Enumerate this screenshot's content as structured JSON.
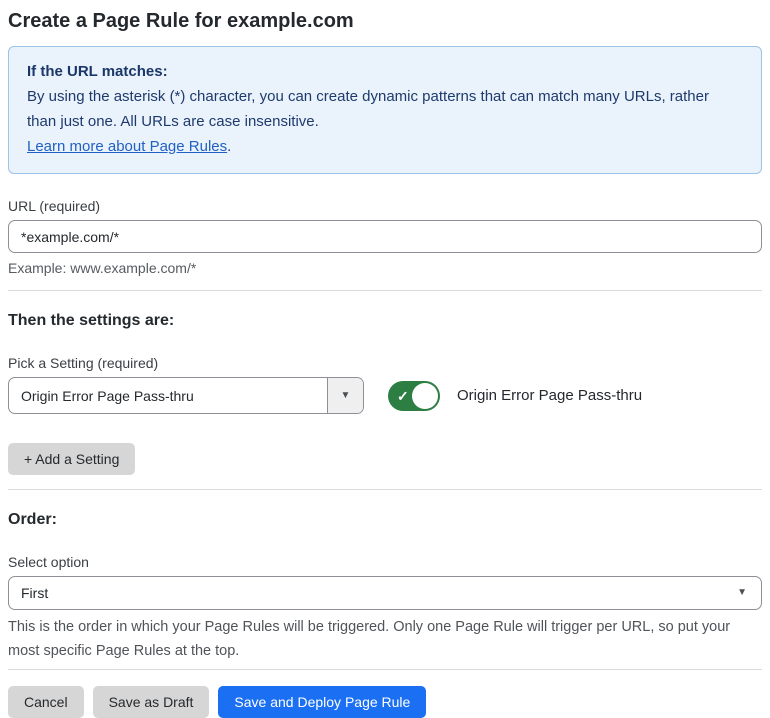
{
  "page": {
    "title": "Create a Page Rule for example.com"
  },
  "info_box": {
    "heading": "If the URL matches:",
    "body": "By using the asterisk (*) character, you can create dynamic patterns that can match many URLs, rather than just one. All URLs are case insensitive.",
    "link_label": "Learn more about Page Rules",
    "link_suffix": "."
  },
  "url_field": {
    "label": "URL (required)",
    "value": "*example.com/*",
    "hint": "Example: www.example.com/*"
  },
  "settings_section": {
    "heading": "Then the settings are:",
    "picker_label": "Pick a Setting (required)",
    "picker_value": "Origin Error Page Pass-thru",
    "toggle_label": "Origin Error Page Pass-thru",
    "toggle_state": "on",
    "add_setting_label": "+ Add a Setting"
  },
  "order_section": {
    "heading": "Order:",
    "select_label": "Select option",
    "select_value": "First",
    "hint": "This is the order in which your Page Rules will be triggered. Only one Page Rule will trigger per URL, so put your most specific Page Rules at the top."
  },
  "footer": {
    "cancel_label": "Cancel",
    "save_draft_label": "Save as Draft",
    "save_deploy_label": "Save and Deploy Page Rule"
  },
  "glyphs": {
    "dropdown_arrow": "▼",
    "check": "✓"
  },
  "colors": {
    "info_box_bg": "#eaf3fb",
    "info_box_border": "#9ec3e8",
    "info_text": "#1e3a6d",
    "link_blue": "#2160c4",
    "toggle_on_green": "#2c7e43",
    "primary_button_blue": "#1a6ff2",
    "secondary_button_gray": "#d6d6d6"
  }
}
